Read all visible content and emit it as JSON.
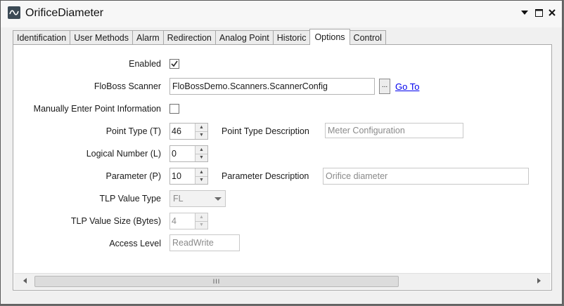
{
  "window": {
    "title": "OrificeDiameter"
  },
  "tabs": [
    {
      "label": "Identification",
      "active": false
    },
    {
      "label": "User Methods",
      "active": false
    },
    {
      "label": "Alarm",
      "active": false
    },
    {
      "label": "Redirection",
      "active": false
    },
    {
      "label": "Analog Point",
      "active": false
    },
    {
      "label": "Historic",
      "active": false
    },
    {
      "label": "Options",
      "active": true
    },
    {
      "label": "Control",
      "active": false
    }
  ],
  "form": {
    "enabled": {
      "label": "Enabled",
      "checked": true
    },
    "floboss_scanner": {
      "label": "FloBoss Scanner",
      "value": "FloBossDemo.Scanners.ScannerConfig",
      "browse_label": "...",
      "goto_label": "Go To"
    },
    "manual_point_info": {
      "label": "Manually Enter Point Information",
      "checked": false
    },
    "point_type": {
      "label": "Point Type (T)",
      "value": "46"
    },
    "point_type_desc": {
      "label": "Point Type Description",
      "value": "Meter Configuration"
    },
    "logical_number": {
      "label": "Logical Number (L)",
      "value": "0"
    },
    "parameter": {
      "label": "Parameter (P)",
      "value": "10"
    },
    "parameter_desc": {
      "label": "Parameter Description",
      "value": "Orifice diameter"
    },
    "tlp_value_type": {
      "label": "TLP Value Type",
      "value": "FL"
    },
    "tlp_value_size": {
      "label": "TLP Value Size (Bytes)",
      "value": "4"
    },
    "access_level": {
      "label": "Access Level",
      "value": "ReadWrite"
    }
  },
  "scrollbar": {
    "thumb_grip": "III",
    "position_fraction": 0.0
  },
  "icons": [
    "app-icon",
    "minimize-dropdown-icon",
    "maximize-icon",
    "close-icon",
    "checkmark-icon",
    "scroll-left-icon",
    "scroll-right-icon"
  ],
  "colors": {
    "link": "#0000ee",
    "panel": "#ffffff",
    "frame": "#f0f0f0"
  }
}
